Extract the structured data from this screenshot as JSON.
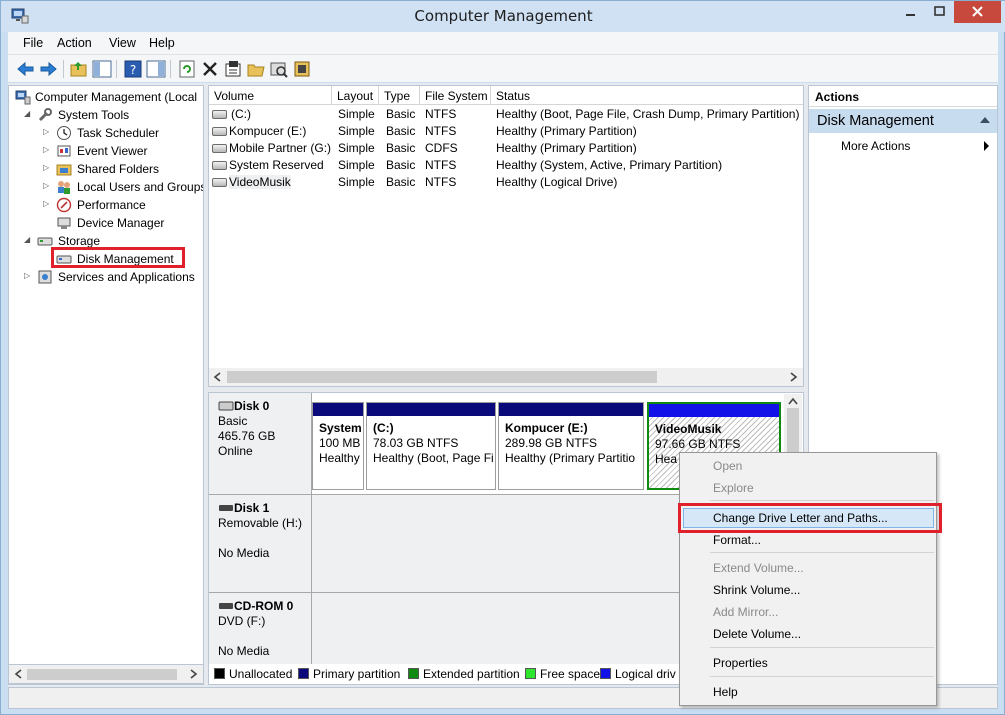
{
  "window": {
    "title": "Computer Management"
  },
  "menubar": [
    "File",
    "Action",
    "View",
    "Help"
  ],
  "toolbar": {
    "icons": [
      "back-arrow-icon",
      "forward-arrow-icon",
      "up-folder-icon",
      "show-hide-tree-icon",
      "help-icon",
      "show-hide-action-pane-icon",
      "refresh-icon",
      "delete-icon",
      "properties-icon",
      "open-icon",
      "rescan-icon",
      "settings-icon"
    ]
  },
  "tree": {
    "root": "Computer Management (Local",
    "system_tools": "System Tools",
    "task_scheduler": "Task Scheduler",
    "event_viewer": "Event Viewer",
    "shared_folders": "Shared Folders",
    "local_users": "Local Users and Groups",
    "performance": "Performance",
    "device_manager": "Device Manager",
    "storage": "Storage",
    "disk_management": "Disk Management",
    "services": "Services and Applications"
  },
  "volume_list": {
    "headers": [
      "Volume",
      "Layout",
      "Type",
      "File System",
      "Status"
    ],
    "rows": [
      [
        "(C:)",
        "Simple",
        "Basic",
        "NTFS",
        "Healthy (Boot, Page File, Crash Dump, Primary Partition)"
      ],
      [
        "Kompucer (E:)",
        "Simple",
        "Basic",
        "NTFS",
        "Healthy (Primary Partition)"
      ],
      [
        "Mobile Partner (G:)",
        "Simple",
        "Basic",
        "CDFS",
        "Healthy (Primary Partition)"
      ],
      [
        "System Reserved",
        "Simple",
        "Basic",
        "NTFS",
        "Healthy (System, Active, Primary Partition)"
      ],
      [
        "VideoMusik",
        "Simple",
        "Basic",
        "NTFS",
        "Healthy (Logical Drive)"
      ]
    ]
  },
  "disks": {
    "disk0": {
      "name": "Disk 0",
      "type": "Basic",
      "size": "465.76 GB",
      "state": "Online"
    },
    "disk1": {
      "name": "Disk 1",
      "type": "Removable (H:)",
      "state": "No Media"
    },
    "cdrom0": {
      "name": "CD-ROM 0",
      "type": "DVD (F:)",
      "state": "No Media"
    }
  },
  "partitions": [
    {
      "name": "System",
      "size": "100 MB",
      "status": "Healthy"
    },
    {
      "name": "(C:)",
      "size": "78.03 GB NTFS",
      "status": "Healthy (Boot, Page Fi"
    },
    {
      "name": "Kompucer  (E:)",
      "size": "289.98 GB NTFS",
      "status": "Healthy (Primary Partitio"
    },
    {
      "name": "VideoMusik",
      "size": "97.66 GB NTFS",
      "status": "Hea"
    }
  ],
  "legend": [
    {
      "label": "Unallocated",
      "color": "#000000"
    },
    {
      "label": "Primary partition",
      "color": "#0a0a7b"
    },
    {
      "label": "Extended partition",
      "color": "#108a10"
    },
    {
      "label": "Free space",
      "color": "#2ee62e"
    },
    {
      "label": "Logical driv",
      "color": "#1212e8"
    }
  ],
  "actions": {
    "header": "Actions",
    "group": "Disk Management",
    "more": "More Actions"
  },
  "context_menu": {
    "open": "Open",
    "explore": "Explore",
    "change_letter": "Change Drive Letter and Paths...",
    "format": "Format...",
    "extend": "Extend Volume...",
    "shrink": "Shrink Volume...",
    "add_mirror": "Add Mirror...",
    "delete": "Delete Volume...",
    "properties": "Properties",
    "help": "Help"
  },
  "colors": {
    "highlight_box": "#e0202a",
    "selected_border": "#0f8a0f",
    "accent": "#c8dcef"
  }
}
